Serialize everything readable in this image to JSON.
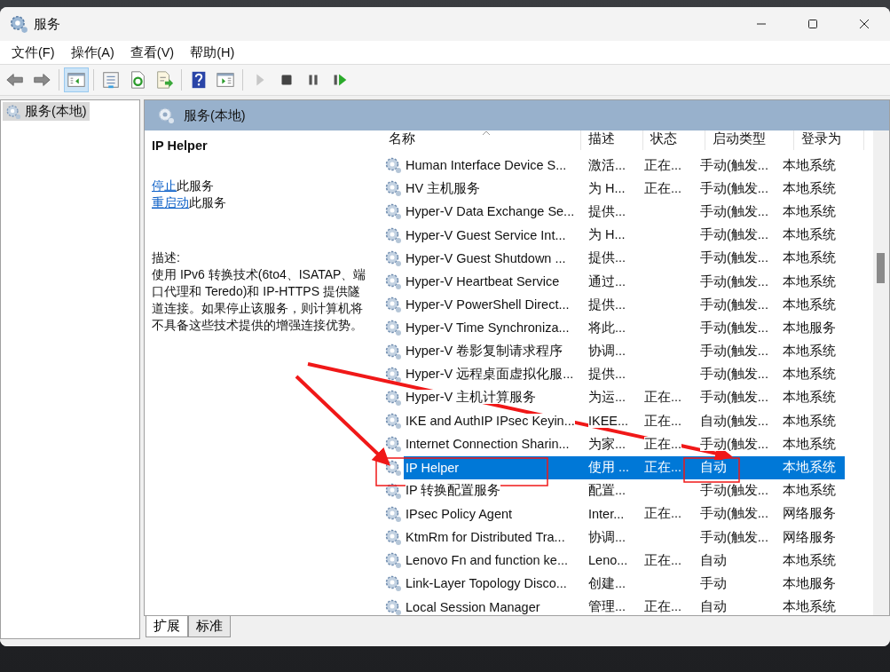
{
  "window": {
    "title": "服务"
  },
  "menu": [
    {
      "label": "文件(F)"
    },
    {
      "label": "操作(A)"
    },
    {
      "label": "查看(V)"
    },
    {
      "label": "帮助(H)"
    }
  ],
  "toolbar": [
    {
      "kind": "back",
      "disabled": false
    },
    {
      "kind": "forward",
      "disabled": false
    },
    {
      "kind": "sep"
    },
    {
      "kind": "tree",
      "selected": true
    },
    {
      "kind": "sep"
    },
    {
      "kind": "properties",
      "selected": false
    },
    {
      "kind": "refresh",
      "selected": false
    },
    {
      "kind": "export",
      "selected": false
    },
    {
      "kind": "sep"
    },
    {
      "kind": "help",
      "selected": false
    },
    {
      "kind": "actionpane",
      "selected": false
    },
    {
      "kind": "sep"
    },
    {
      "kind": "play",
      "disabled": true
    },
    {
      "kind": "stop",
      "disabled": false
    },
    {
      "kind": "pause",
      "disabled": false
    },
    {
      "kind": "resume",
      "disabled": false
    }
  ],
  "tree": {
    "items": [
      {
        "label": "服务(本地)",
        "selected": true
      }
    ]
  },
  "panel": {
    "title": "服务(本地)"
  },
  "details": {
    "service_name": "IP Helper",
    "actions": [
      {
        "link": "停止",
        "text": "此服务"
      },
      {
        "link": "重启动",
        "text": "此服务"
      }
    ],
    "description_label": "描述:",
    "description": "使用 IPv6 转换技术(6to4、ISATAP、端口代理和 Teredo)和 IP-HTTPS 提供隧道连接。如果停止该服务，则计算机将不具备这些技术提供的增强连接优势。"
  },
  "table": {
    "columns": [
      "名称",
      "描述",
      "状态",
      "启动类型",
      "登录为"
    ],
    "rows": [
      {
        "name": "Human Interface Device S...",
        "description": "激活...",
        "status": "正在...",
        "startup": "手动(触发...",
        "logon": "本地系统",
        "selected": false
      },
      {
        "name": "HV 主机服务",
        "description": "为 H...",
        "status": "正在...",
        "startup": "手动(触发...",
        "logon": "本地系统",
        "selected": false
      },
      {
        "name": "Hyper-V Data Exchange Se...",
        "description": "提供...",
        "status": "",
        "startup": "手动(触发...",
        "logon": "本地系统",
        "selected": false
      },
      {
        "name": "Hyper-V Guest Service Int...",
        "description": "为 H...",
        "status": "",
        "startup": "手动(触发...",
        "logon": "本地系统",
        "selected": false
      },
      {
        "name": "Hyper-V Guest Shutdown ...",
        "description": "提供...",
        "status": "",
        "startup": "手动(触发...",
        "logon": "本地系统",
        "selected": false
      },
      {
        "name": "Hyper-V Heartbeat Service",
        "description": "通过...",
        "status": "",
        "startup": "手动(触发...",
        "logon": "本地系统",
        "selected": false
      },
      {
        "name": "Hyper-V PowerShell Direct...",
        "description": "提供...",
        "status": "",
        "startup": "手动(触发...",
        "logon": "本地系统",
        "selected": false
      },
      {
        "name": "Hyper-V Time Synchroniza...",
        "description": "将此...",
        "status": "",
        "startup": "手动(触发...",
        "logon": "本地服务",
        "selected": false
      },
      {
        "name": "Hyper-V 卷影复制请求程序",
        "description": "协调...",
        "status": "",
        "startup": "手动(触发...",
        "logon": "本地系统",
        "selected": false
      },
      {
        "name": "Hyper-V 远程桌面虚拟化服...",
        "description": "提供...",
        "status": "",
        "startup": "手动(触发...",
        "logon": "本地系统",
        "selected": false
      },
      {
        "name": "Hyper-V 主机计算服务",
        "description": "为运...",
        "status": "正在...",
        "startup": "手动(触发...",
        "logon": "本地系统",
        "selected": false
      },
      {
        "name": "IKE and AuthIP IPsec Keyin...",
        "description": "IKEE...",
        "status": "正在...",
        "startup": "自动(触发...",
        "logon": "本地系统",
        "selected": false
      },
      {
        "name": "Internet Connection Sharin...",
        "description": "为家...",
        "status": "正在...",
        "startup": "手动(触发...",
        "logon": "本地系统",
        "selected": false
      },
      {
        "name": "IP Helper",
        "description": "使用 ...",
        "status": "正在...",
        "startup": "自动",
        "logon": "本地系统",
        "selected": true
      },
      {
        "name": "IP 转换配置服务",
        "description": "配置...",
        "status": "",
        "startup": "手动(触发...",
        "logon": "本地系统",
        "selected": false
      },
      {
        "name": "IPsec Policy Agent",
        "description": "Inter...",
        "status": "正在...",
        "startup": "手动(触发...",
        "logon": "网络服务",
        "selected": false
      },
      {
        "name": "KtmRm for Distributed Tra...",
        "description": "协调...",
        "status": "",
        "startup": "手动(触发...",
        "logon": "网络服务",
        "selected": false
      },
      {
        "name": "Lenovo Fn and function ke...",
        "description": "Leno...",
        "status": "正在...",
        "startup": "自动",
        "logon": "本地系统",
        "selected": false
      },
      {
        "name": "Link-Layer Topology Disco...",
        "description": "创建...",
        "status": "",
        "startup": "手动",
        "logon": "本地服务",
        "selected": false
      },
      {
        "name": "Local Session Manager",
        "description": "管理...",
        "status": "正在...",
        "startup": "自动",
        "logon": "本地系统",
        "selected": false
      }
    ]
  },
  "bottom_tabs": [
    {
      "label": "扩展",
      "selected": true
    },
    {
      "label": "标准",
      "selected": false
    }
  ]
}
